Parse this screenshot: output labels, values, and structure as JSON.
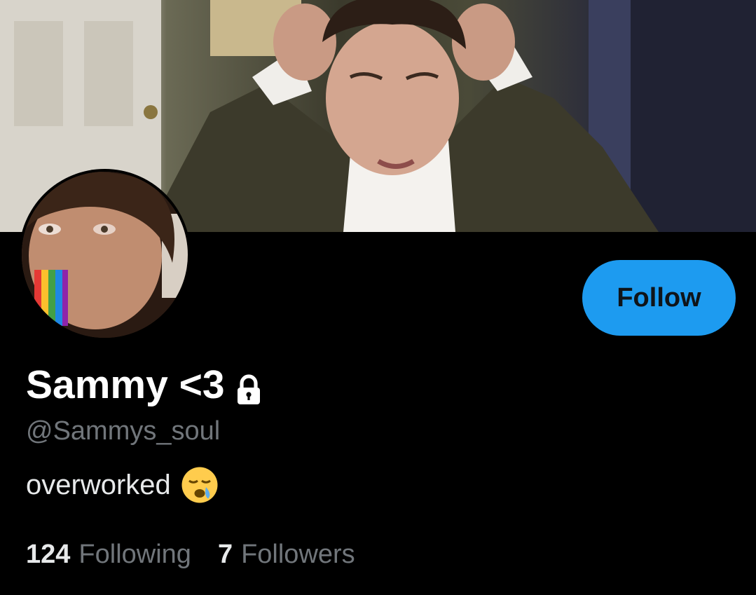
{
  "profile": {
    "display_name": "Sammy <3",
    "handle": "@Sammys_soul",
    "bio_text": "overworked",
    "bio_emoji": "sleepy-face-icon",
    "protected_icon": "lock-icon",
    "follow_label": "Follow",
    "following_count": "124",
    "following_label": "Following",
    "followers_count": "7",
    "followers_label": "Followers"
  },
  "colors": {
    "background": "#000000",
    "accent": "#1d9bf0",
    "primary_text": "#ffffff",
    "secondary_text": "#71767b"
  }
}
